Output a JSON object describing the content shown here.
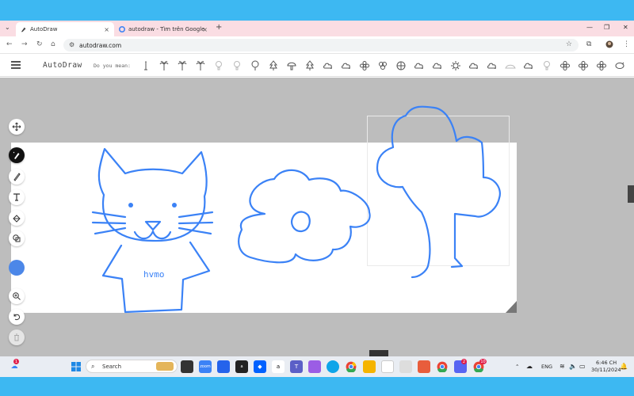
{
  "browser": {
    "tabs": [
      {
        "label": "AutoDraw",
        "active": true
      },
      {
        "label": "autodraw - Tìm trên Google",
        "active": false
      }
    ],
    "new_tab_symbol": "+",
    "close_symbol": "×",
    "url": "autodraw.com"
  },
  "app": {
    "name": "AutoDraw",
    "suggestion_label": "Do you mean:",
    "suggestions": [
      "candle-icon",
      "palm-tree-icon",
      "palm-tree-icon",
      "palm-tree-icon",
      "bulb-icon",
      "bulb-icon",
      "lollipop-icon",
      "tree-icon",
      "mushroom-icon",
      "tree-icon",
      "cloud-icon",
      "cloud-icon",
      "flower-icon",
      "clover-icon",
      "ball-icon",
      "cloud-icon",
      "cloud-icon",
      "gear-icon",
      "cloud-icon",
      "cloud-icon",
      "hill-icon",
      "cloud-icon",
      "bulb-icon",
      "flower-icon",
      "flower-icon",
      "flower-icon",
      "pig-icon"
    ],
    "drawing_text": "hvmo",
    "stroke_color": "#3b82f6",
    "selected_color": "#4c87e8"
  },
  "tools": [
    {
      "name": "move-tool-icon"
    },
    {
      "name": "autodraw-tool-icon",
      "active": true
    },
    {
      "name": "draw-tool-icon"
    },
    {
      "name": "type-tool-icon"
    },
    {
      "name": "fill-tool-icon"
    },
    {
      "name": "shape-tool-icon"
    },
    {
      "name": "color-picker"
    },
    {
      "name": "zoom-tool-icon"
    },
    {
      "name": "undo-icon"
    },
    {
      "name": "delete-icon"
    }
  ],
  "taskbar": {
    "search_placeholder": "Search",
    "weather_badge": "1",
    "discord_badge": "2",
    "chrome_badge": "10",
    "language": "ENG",
    "time": "6:46 CH",
    "date": "30/11/2024"
  }
}
